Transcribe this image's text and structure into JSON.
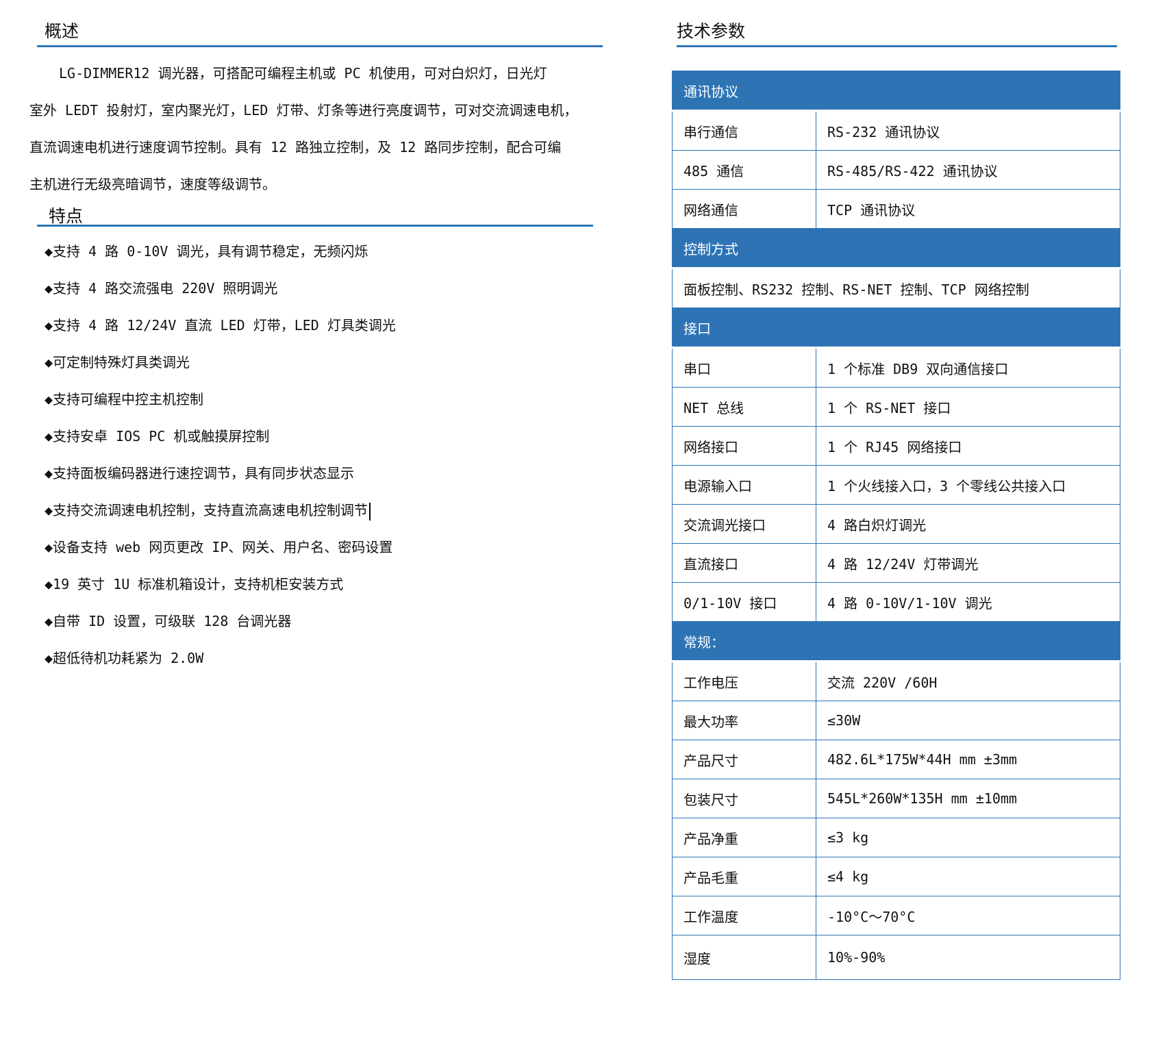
{
  "overview": {
    "title": "概述",
    "lines": [
      "LG-DIMMER12 调光器，可搭配可编程主机或 PC 机使用，可对白炽灯，日光灯",
      "室外 LEDT 投射灯，室内聚光灯，LED 灯带、灯条等进行亮度调节，可对交流调速电机，",
      "直流调速电机进行速度调节控制。具有 12 路独立控制，及 12 路同步控制，配合可编",
      "主机进行无级亮暗调节，速度等级调节。"
    ]
  },
  "features": {
    "title": "特点",
    "items": [
      "◆支持 4 路 0-10V 调光，具有调节稳定，无频闪烁",
      "◆支持 4 路交流强电 220V 照明调光",
      "◆支持 4 路 12/24V 直流 LED 灯带，LED 灯具类调光",
      "◆可定制特殊灯具类调光",
      "◆支持可编程中控主机控制",
      "◆支持安卓 IOS  PC 机或触摸屏控制",
      "◆支持面板编码器进行速控调节，具有同步状态显示",
      "◆支持交流调速电机控制，支持直流高速电机控制调节",
      "◆设备支持 web 网页更改 IP、网关、用户名、密码设置",
      "◆19 英寸 1U 标准机箱设计，支持机柜安装方式",
      "◆自带 ID 设置，可级联 128 台调光器",
      "◆超低待机功耗紧为 2.0W"
    ]
  },
  "specs": {
    "title": "技术参数",
    "sections": [
      {
        "header": "通讯协议",
        "rows": [
          [
            "串行通信",
            "RS-232  通讯协议"
          ],
          [
            "485 通信",
            "RS-485/RS-422  通讯协议"
          ],
          [
            "网络通信",
            "TCP 通讯协议"
          ]
        ]
      },
      {
        "header": "控制方式",
        "full": "面板控制、RS232 控制、RS-NET 控制、TCP 网络控制"
      },
      {
        "header": "接口",
        "rows": [
          [
            "串口",
            "1 个标准 DB9 双向通信接口"
          ],
          [
            "NET 总线",
            "1 个 RS-NET 接口"
          ],
          [
            "网络接口",
            "1 个 RJ45 网络接口"
          ],
          [
            "电源输入口",
            "1 个火线接入口，3 个零线公共接入口"
          ],
          [
            "交流调光接口",
            "4 路白炽灯调光"
          ],
          [
            "直流接口",
            "4 路 12/24V 灯带调光"
          ],
          [
            "0/1-10V 接口",
            "4 路 0-10V/1-10V 调光"
          ]
        ]
      },
      {
        "header": "常规：",
        "rows": [
          [
            "工作电压",
            "交流 220V /60H"
          ],
          [
            "最大功率",
            "≤30W"
          ],
          [
            "产品尺寸",
            "482.6L*175W*44H mm ±3mm"
          ],
          [
            "包装尺寸",
            "545L*260W*135H mm  ±10mm"
          ],
          [
            "产品净重",
            "≤3 kg"
          ],
          [
            "产品毛重",
            "≤4 kg"
          ],
          [
            "工作温度",
            "-10°C～70°C"
          ],
          [
            "湿度",
            "10%-90%"
          ]
        ]
      }
    ]
  },
  "colors": {
    "accent": "#2E74B5"
  }
}
